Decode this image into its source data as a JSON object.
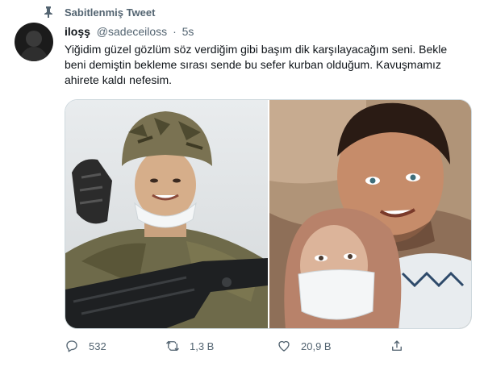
{
  "pinned": {
    "label": "Sabitlenmiş Tweet",
    "icon": "pin-icon"
  },
  "author": {
    "display_name": "iloşş",
    "handle": "@sadeceiloss",
    "separator": "·",
    "time": "5s"
  },
  "tweet": {
    "text": "Yiğidim güzel gözlüm söz verdiğim gibi başım dik karşılayacağım seni. Bekle beni demiştin bekleme sırası sende bu sefer kurban olduğum. Kavuşmamız ahirete kaldı nefesim."
  },
  "media": {
    "left_photo": "soldier-in-helmet-saluting-photo",
    "right_photo": "couple-selfie-photo"
  },
  "actions": {
    "reply": {
      "icon": "reply-icon",
      "count": "532"
    },
    "retweet": {
      "icon": "retweet-icon",
      "count": "1,3 B"
    },
    "like": {
      "icon": "heart-icon",
      "count": "20,9 B"
    },
    "share": {
      "icon": "share-icon"
    }
  },
  "colors": {
    "text": "#0f1419",
    "secondary": "#536471",
    "border": "#cfd9de"
  }
}
